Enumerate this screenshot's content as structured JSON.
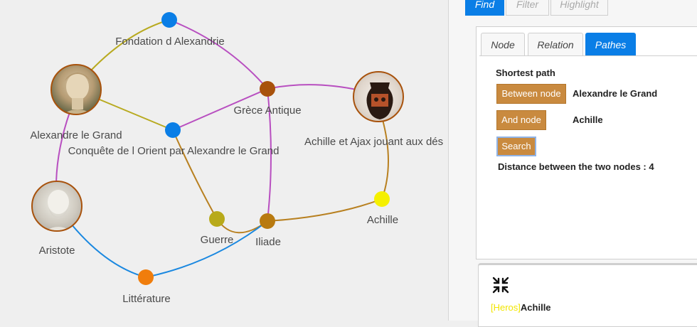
{
  "graph": {
    "nodes": {
      "fondation": "Fondation d Alexandrie",
      "alexandre": "Alexandre le Grand",
      "conquete": "Conquête de l Orient par Alexandre le Grand",
      "grece": "Grèce Antique",
      "achille_ajax": "Achille et Ajax jouant aux dés",
      "aristote": "Aristote",
      "guerre": "Guerre",
      "iliade": "Iliade",
      "achille": "Achille",
      "litterature": "Littérature"
    },
    "colors": {
      "blue_node": "#0a7ee6",
      "brown_node": "#a8520c",
      "olive_node": "#b8aa1a",
      "yellow_node": "#f5f000",
      "orange_node": "#f07d0c",
      "edge_olive": "#b8aa20",
      "edge_magenta": "#b84fc0",
      "edge_brown": "#b88020",
      "edge_blue": "#1a88e0"
    }
  },
  "panel": {
    "top_tabs": [
      "Find",
      "Filter",
      "Highlight"
    ],
    "sub_tabs": [
      "Node",
      "Relation",
      "Pathes"
    ],
    "heading": "Shortest path",
    "between_button": "Between node",
    "between_value": "Alexandre le Grand",
    "and_button": "And node",
    "and_value": "Achille",
    "search_button": "Search",
    "distance": "Distance between the two nodes : 4",
    "result_category": "[Heros]",
    "result_name": "Achille",
    "result_category_color": "#f2e600",
    "collapse_icon": "collapse-arrows-icon"
  }
}
